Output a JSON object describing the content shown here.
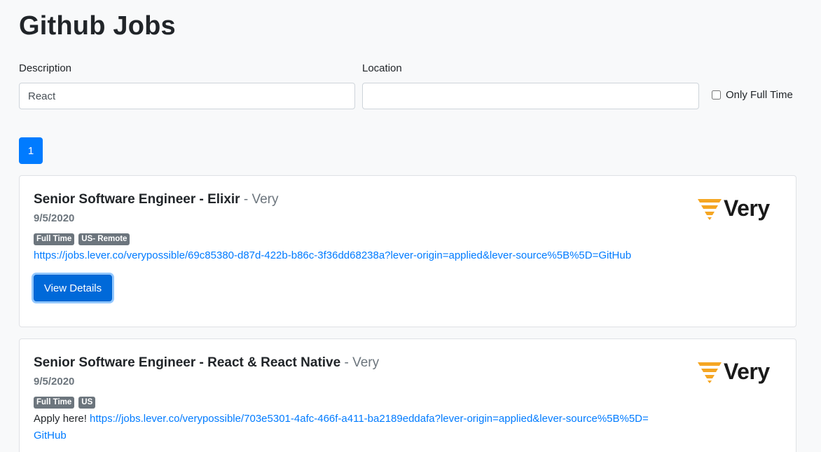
{
  "header": {
    "title": "Github Jobs"
  },
  "search": {
    "description_label": "Description",
    "description_value": "React",
    "location_label": "Location",
    "location_value": "",
    "fulltime_label": "Only Full Time"
  },
  "pagination": {
    "current_page": "1"
  },
  "jobs": [
    {
      "title": "Senior Software Engineer - Elixir",
      "separator": " - ",
      "company": "Very",
      "date": "9/5/2020",
      "badges": [
        "Full Time",
        "US- Remote"
      ],
      "prefix": "",
      "url": "https://jobs.lever.co/verypossible/69c85380-d87d-422b-b86c-3f36dd68238a?lever-origin=applied&lever-source%5B%5D=GitHub",
      "logo_text": "Very",
      "button_label": "View Details"
    },
    {
      "title": "Senior Software Engineer - React & React Native",
      "separator": " - ",
      "company": "Very",
      "date": "9/5/2020",
      "badges": [
        "Full Time",
        "US"
      ],
      "prefix": "Apply here! ",
      "url": "https://jobs.lever.co/verypossible/703e5301-4afc-466f-a411-ba2189eddafa?lever-origin=applied&lever-source%5B%5D=",
      "url_cont": "GitHub",
      "logo_text": "Very"
    }
  ],
  "colors": {
    "primary": "#007bff",
    "badge": "#6c757d",
    "logo_accent": "#f5a623"
  }
}
